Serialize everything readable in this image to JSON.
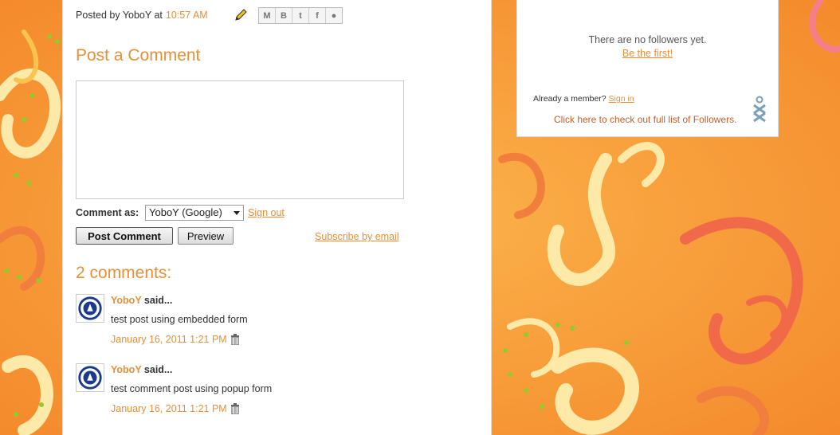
{
  "post": {
    "posted_by": "Posted by YoboY at",
    "time": "10:57 AM",
    "share_icons": [
      "gmail-icon",
      "blogger-icon",
      "twitter-icon",
      "facebook-icon",
      "buzz-icon"
    ]
  },
  "comment_form": {
    "title": "Post a Comment",
    "comment_as_label": "Comment as:",
    "account_selected": "YoboY (Google)",
    "sign_out": "Sign out",
    "post_button": "Post Comment",
    "preview_button": "Preview",
    "subscribe": "Subscribe by email"
  },
  "comments": {
    "count_label": "2 comments:",
    "items": [
      {
        "author": "YoboY",
        "said": "said...",
        "text": "test post using embedded form",
        "date": "January 16, 2011 1:21 PM"
      },
      {
        "author": "YoboY",
        "said": "said...",
        "text": "test comment post using popup form",
        "date": "January 16, 2011 1:21 PM"
      }
    ]
  },
  "followers": {
    "no_followers": "There are no followers yet.",
    "be_first": "Be the first!",
    "already_member": "Already a member?",
    "sign_in": "Sign in",
    "full_list": "Click here to check out full list of Followers."
  },
  "colors": {
    "accent": "#e69138",
    "background": "#f7a13d"
  }
}
